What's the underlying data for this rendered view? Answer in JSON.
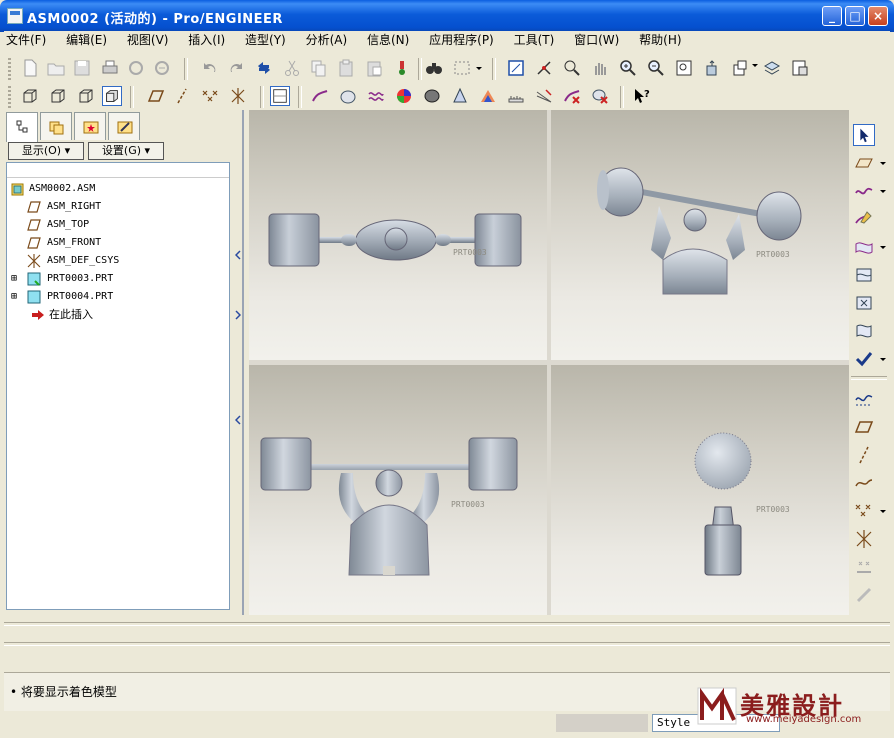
{
  "window": {
    "title": "ASM0002 (活动的) - Pro/ENGINEER",
    "minimize": "_",
    "maximize": "□",
    "close": "×"
  },
  "menu": [
    "文件(F)",
    "编辑(E)",
    "视图(V)",
    "插入(I)",
    "造型(Y)",
    "分析(A)",
    "信息(N)",
    "应用程序(P)",
    "工具(T)",
    "窗口(W)",
    "帮助(H)"
  ],
  "panel": {
    "show_button": "显示(O) ▾",
    "settings_button": "设置(G) ▾"
  },
  "tree": {
    "root": "ASM0002.ASM",
    "items": [
      "ASM_RIGHT",
      "ASM_TOP",
      "ASM_FRONT",
      "ASM_DEF_CSYS",
      "PRT0003.PRT",
      "PRT0004.PRT",
      "在此插入"
    ],
    "expanders": [
      "⊞",
      "⊞"
    ]
  },
  "viewport": {
    "part_label": "PRT0003"
  },
  "message": {
    "text": "• 将要显示着色模型"
  },
  "status": {
    "style_label": "Style"
  },
  "watermark": {
    "brand": "美雅設計",
    "url": "www.meiyadesign.com"
  },
  "colors": {
    "title_blue": "#0b5bd9",
    "model_gray": "#a9b2bc",
    "datum_brown": "#7a4a1a",
    "watermark_red": "#8b1d1d"
  }
}
